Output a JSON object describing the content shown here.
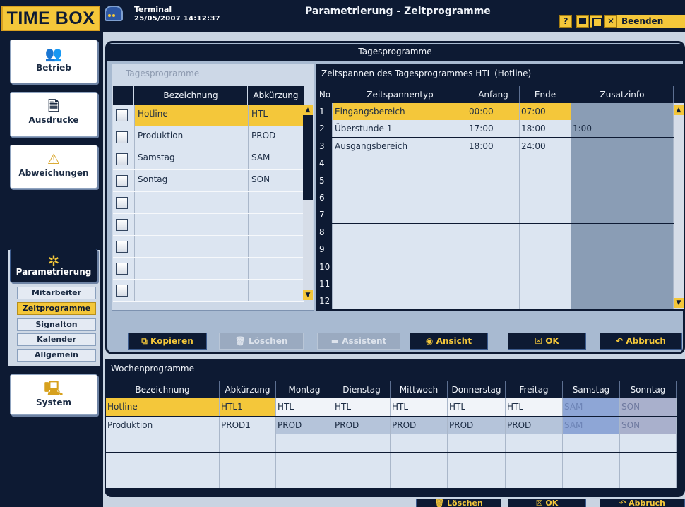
{
  "header": {
    "logo": "TIME BOX",
    "terminal_label": "Terminal",
    "datetime": "25/05/2007 14:12:37",
    "window_title": "Parametrierung - Zeitprogramme",
    "help": "?",
    "beenden": "Beenden"
  },
  "sidebar": {
    "betrieb": "Betrieb",
    "ausdrucke": "Ausdrucke",
    "abweichungen": "Abweichungen",
    "parametrierung": "Parametrierung",
    "sub": [
      "Mitarbeiter",
      "Zeitprogramme",
      "Signalton",
      "Kalender",
      "Allgemein"
    ],
    "system": "System"
  },
  "tages": {
    "frame_title": "Tagesprogramme",
    "left_title": "Tagesprogramme",
    "left_headers": {
      "bez": "Bezeichnung",
      "abk": "Abkürzung"
    },
    "rows": [
      {
        "bez": "Hotline",
        "abk": "HTL"
      },
      {
        "bez": "Produktion",
        "abk": "PROD"
      },
      {
        "bez": "Samstag",
        "abk": "SAM"
      },
      {
        "bez": "Sontag",
        "abk": "SON"
      },
      {
        "bez": "",
        "abk": ""
      },
      {
        "bez": "",
        "abk": ""
      },
      {
        "bez": "",
        "abk": ""
      },
      {
        "bez": "",
        "abk": ""
      },
      {
        "bez": "",
        "abk": ""
      }
    ],
    "right_title": "Zeitspannen des Tagesprogrammes HTL (Hotline)",
    "right_headers": {
      "no": "No",
      "typ": "Zeitspannentyp",
      "an": "Anfang",
      "en": "Ende",
      "zu": "Zusatzinfo"
    },
    "spans": [
      {
        "no": "1",
        "typ": "Eingangsbereich",
        "an": "00:00",
        "en": "07:00",
        "zu": ""
      },
      {
        "no": "2",
        "typ": "Überstunde 1",
        "an": "17:00",
        "en": "18:00",
        "zu": "1:00"
      },
      {
        "no": "3",
        "typ": "Ausgangsbereich",
        "an": "18:00",
        "en": "24:00",
        "zu": ""
      },
      {
        "no": "4",
        "typ": "",
        "an": "",
        "en": "",
        "zu": ""
      },
      {
        "no": "5",
        "typ": "",
        "an": "",
        "en": "",
        "zu": ""
      },
      {
        "no": "6",
        "typ": "",
        "an": "",
        "en": "",
        "zu": ""
      },
      {
        "no": "7",
        "typ": "",
        "an": "",
        "en": "",
        "zu": ""
      },
      {
        "no": "8",
        "typ": "",
        "an": "",
        "en": "",
        "zu": ""
      },
      {
        "no": "9",
        "typ": "",
        "an": "",
        "en": "",
        "zu": ""
      },
      {
        "no": "10",
        "typ": "",
        "an": "",
        "en": "",
        "zu": ""
      },
      {
        "no": "11",
        "typ": "",
        "an": "",
        "en": "",
        "zu": ""
      },
      {
        "no": "12",
        "typ": "",
        "an": "",
        "en": "",
        "zu": ""
      }
    ]
  },
  "buttons": {
    "kopieren": "Kopieren",
    "loeschen": "Löschen",
    "assistent": "Assistent",
    "ansicht": "Ansicht",
    "ok": "OK",
    "abbruch": "Abbruch"
  },
  "wochen": {
    "title": "Wochenprogramme",
    "headers": [
      "Bezeichnung",
      "Abkürzung",
      "Montag",
      "Dienstag",
      "Mittwoch",
      "Donnerstag",
      "Freitag",
      "Samstag",
      "Sonntag"
    ],
    "rows": [
      [
        "Hotline",
        "HTL1",
        "HTL",
        "HTL",
        "HTL",
        "HTL",
        "HTL",
        "SAM",
        "SON"
      ],
      [
        "Produktion",
        "PROD1",
        "PROD",
        "PROD",
        "PROD",
        "PROD",
        "PROD",
        "SAM",
        "SON"
      ],
      [
        "",
        "",
        "",
        "",
        "",
        "",
        "",
        "",
        ""
      ],
      [
        "",
        "",
        "",
        "",
        "",
        "",
        "",
        "",
        ""
      ],
      [
        "",
        "",
        "",
        "",
        "",
        "",
        "",
        "",
        ""
      ]
    ]
  },
  "bottom_buttons": {
    "loeschen": "Löschen",
    "ok": "OK",
    "abbruch": "Abbruch"
  },
  "colors": {
    "navy": "#0d1a33",
    "accent_yellow": "#f4c73a",
    "panel_blue": "#a8bad1"
  }
}
